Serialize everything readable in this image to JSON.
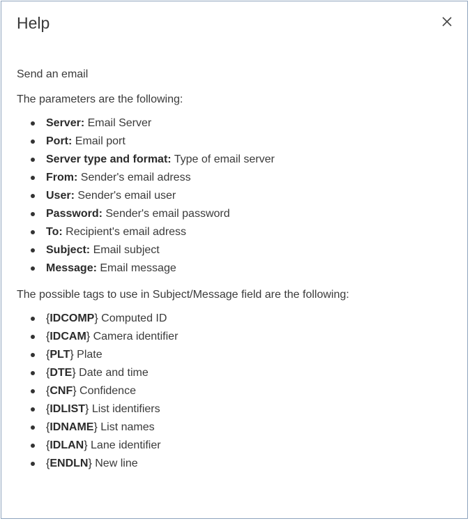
{
  "dialog": {
    "title": "Help",
    "close_icon": "close-icon",
    "intro": "Send an email",
    "params_heading": "The parameters are the following:",
    "params": [
      {
        "term": "Server:",
        "desc": "Email Server"
      },
      {
        "term": "Port:",
        "desc": "Email port"
      },
      {
        "term": "Server type and format:",
        "desc": "Type of email server"
      },
      {
        "term": "From:",
        "desc": "Sender's email adress"
      },
      {
        "term": "User:",
        "desc": "Sender's email user"
      },
      {
        "term": "Password:",
        "desc": "Sender's email password"
      },
      {
        "term": "To:",
        "desc": "Recipient's email adress"
      },
      {
        "term": "Subject:",
        "desc": "Email subject"
      },
      {
        "term": "Message:",
        "desc": "Email message"
      }
    ],
    "tags_heading": "The possible tags to use in Subject/Message field are the following:",
    "tags": [
      {
        "tag": "IDCOMP",
        "desc": "Computed ID"
      },
      {
        "tag": "IDCAM",
        "desc": "Camera identifier"
      },
      {
        "tag": "PLT",
        "desc": "Plate"
      },
      {
        "tag": "DTE",
        "desc": "Date and time"
      },
      {
        "tag": "CNF",
        "desc": "Confidence"
      },
      {
        "tag": "IDLIST",
        "desc": "List identifiers"
      },
      {
        "tag": "IDNAME",
        "desc": "List names"
      },
      {
        "tag": "IDLAN",
        "desc": "Lane identifier"
      },
      {
        "tag": "ENDLN",
        "desc": "New line"
      }
    ],
    "brace_open": "{",
    "brace_close": "}"
  }
}
